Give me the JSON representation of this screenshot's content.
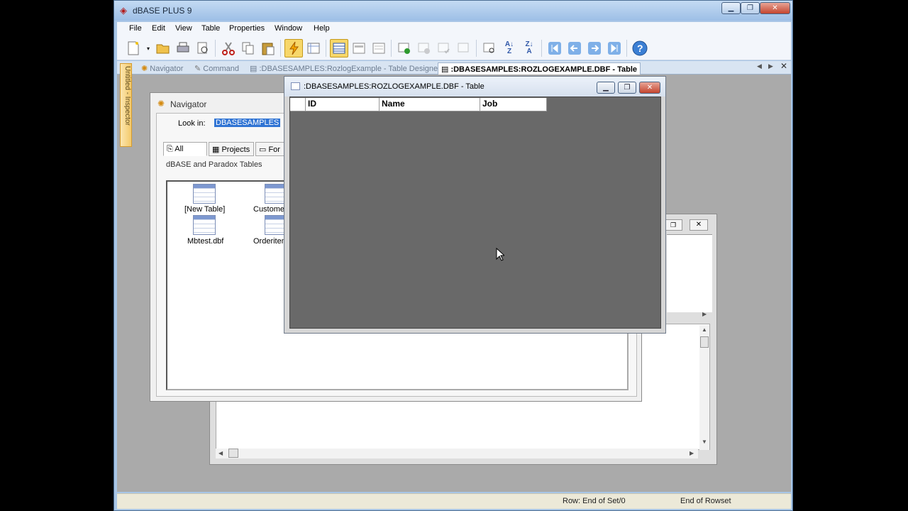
{
  "app": {
    "title": "dBASE PLUS 9",
    "menus": [
      "File",
      "Edit",
      "View",
      "Table",
      "Properties",
      "Window",
      "Help"
    ]
  },
  "tabs": {
    "navigator": "Navigator",
    "command": "Command",
    "designer": ":DBASESAMPLES:RozlogExample - Table Designer",
    "table": ":DBASESAMPLES:ROZLOGEXAMPLE.DBF - Table"
  },
  "inspector": {
    "label": "Untitled - Inspector"
  },
  "navigator": {
    "title": "Navigator",
    "look_in_label": "Look in:",
    "look_in_value": "DBASESAMPLES",
    "tab_all": "All",
    "tab_projects": "Projects",
    "tab_forms": "For",
    "section_label": "dBASE and Paradox Tables",
    "files": [
      "[New Table]",
      "Customers",
      "Mbtest.dbf",
      "Orderitem"
    ]
  },
  "table_window": {
    "title": ":DBASESAMPLES:ROZLOGEXAMPLE.DBF - Table",
    "columns": [
      "ID",
      "Name",
      "Job"
    ]
  },
  "status": {
    "row": "Row: End of Set/0",
    "rowset": "End of Rowset"
  },
  "colors": {
    "accent": "#f7d76a",
    "titlebar": "#9dbfe6",
    "grid_bg": "#696969"
  }
}
